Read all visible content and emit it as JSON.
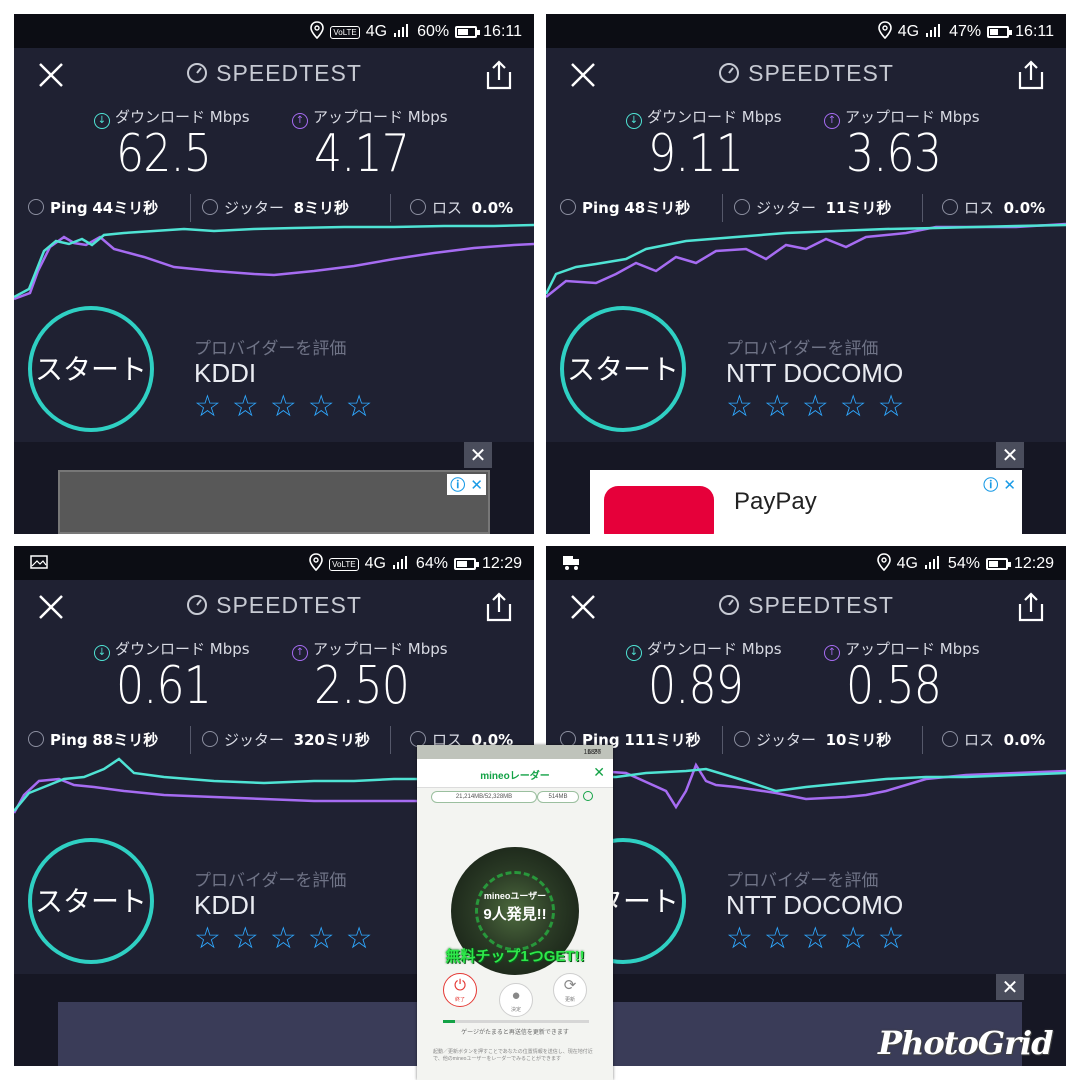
{
  "panels": [
    {
      "status": {
        "network": "4G",
        "battery": "60%",
        "battery_level": 0.6,
        "time": "16:11",
        "left_icon": "",
        "volte": "VO LTE"
      },
      "title": "SPEEDTEST",
      "download_label": "ダウンロード Mbps",
      "upload_label": "アップロード Mbps",
      "download": "62.5",
      "upload": "4.17",
      "ping_label": "Ping",
      "ping": "44ミリ秒",
      "jitter_label": "ジッター",
      "jitter": "8ミリ秒",
      "loss_label": "ロス",
      "loss": "0.0%",
      "start_label": "スタート",
      "rate_label": "プロバイダーを評価",
      "provider": "KDDI",
      "ad": {
        "type": "gray",
        "name": ""
      }
    },
    {
      "status": {
        "network": "4G",
        "battery": "47%",
        "battery_level": 0.47,
        "time": "16:11",
        "left_icon": "",
        "volte": ""
      },
      "title": "SPEEDTEST",
      "download_label": "ダウンロード Mbps",
      "upload_label": "アップロード Mbps",
      "download": "9.11",
      "upload": "3.63",
      "ping_label": "Ping",
      "ping": "48ミリ秒",
      "jitter_label": "ジッター",
      "jitter": "11ミリ秒",
      "loss_label": "ロス",
      "loss": "0.0%",
      "start_label": "スタート",
      "rate_label": "プロバイダーを評価",
      "provider": "NTT DOCOMO",
      "ad": {
        "type": "paypay",
        "name": "PayPay"
      }
    },
    {
      "status": {
        "network": "4G",
        "battery": "64%",
        "battery_level": 0.64,
        "time": "12:29",
        "left_icon": "image",
        "volte": "VO LTE"
      },
      "title": "SPEEDTEST",
      "download_label": "ダウンロード Mbps",
      "upload_label": "アップロード Mbps",
      "download": "0.61",
      "upload": "2.50",
      "ping_label": "Ping",
      "ping": "88ミリ秒",
      "jitter_label": "ジッター",
      "jitter": "320ミリ秒",
      "loss_label": "ロス",
      "loss": "0.0%",
      "start_label": "スタート",
      "rate_label": "プロバイダーを評価",
      "provider": "KDDI",
      "ad": {
        "type": "blue",
        "name": ""
      }
    },
    {
      "status": {
        "network": "4G",
        "battery": "54%",
        "battery_level": 0.54,
        "time": "12:29",
        "left_icon": "truck",
        "volte": ""
      },
      "title": "SPEEDTEST",
      "download_label": "ダウンロード Mbps",
      "upload_label": "アップロード Mbps",
      "download": "0.89",
      "upload": "0.58",
      "ping_label": "Ping",
      "ping": "111ミリ秒",
      "jitter_label": "ジッター",
      "jitter": "10ミリ秒",
      "loss_label": "ロス",
      "loss": "0.0%",
      "start_label": "スタート",
      "rate_label": "プロバイダーを評価",
      "provider": "NTT DOCOMO",
      "ad": {
        "type": "blue",
        "name": ""
      }
    }
  ],
  "mineo": {
    "status_time": "16:27",
    "status_battery": "18%",
    "title": "mineoレーダー",
    "data_used": "21,214MB/52,328MB",
    "data_chip": "514MB",
    "radar_line1": "mineoユーザー",
    "radar_line2": "9人発見!!",
    "get_message": "無料チップ1つGET!!",
    "btn_end": "終了",
    "btn_stop": "決定",
    "btn_refresh": "更新",
    "gauge_level": 0.08,
    "note": "ゲージがたまると再送信を更新できます",
    "desc": "起動／更新ボタンを押すことであなたの位置情報を送信し、現在地付近で、他のmineoユーザーをレーダーでみることができます"
  },
  "watermark": "PhotoGrid",
  "colors": {
    "download": "#4fe3d4",
    "upload": "#a66cf2",
    "accent": "#2fd0c3",
    "star": "#2fa8ff",
    "panel_bg": "#1f2132"
  }
}
